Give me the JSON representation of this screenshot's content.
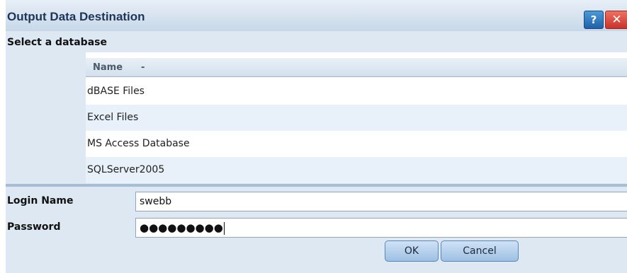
{
  "dialog": {
    "title": "Output Data Destination",
    "help_icon": "?",
    "close_icon": "✕"
  },
  "database_section": {
    "label": "Select a database",
    "columns": [
      "Name"
    ],
    "sort_indicator": "-",
    "rows": [
      "dBASE Files",
      "Excel Files",
      "MS Access Database",
      "SQLServer2005"
    ]
  },
  "login": {
    "login_label": "Login Name",
    "login_value": "swebb",
    "password_label": "Password",
    "password_value": "●●●●●●●●●"
  },
  "buttons": {
    "ok": "OK",
    "cancel": "Cancel"
  },
  "icons": {
    "help": "help-icon",
    "close": "close-icon"
  },
  "colors": {
    "accent": "#2060a8",
    "close": "#c8322a",
    "background": "#dde8f2",
    "row_alt": "#e8f1fa"
  }
}
